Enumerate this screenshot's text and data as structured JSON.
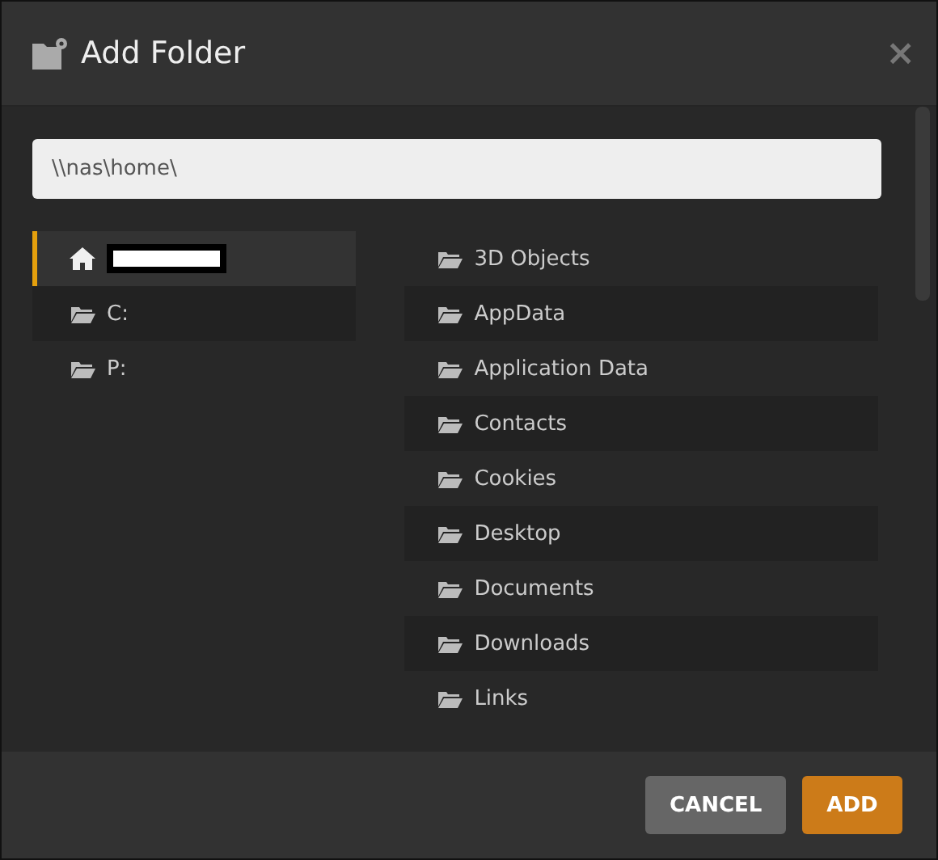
{
  "dialog": {
    "title": "Add Folder",
    "close": "×"
  },
  "path_field": {
    "value": "\\\\nas\\home\\"
  },
  "locations": [
    {
      "kind": "home",
      "redacted": true,
      "selected": true
    },
    {
      "kind": "folder",
      "label": "C:",
      "redacted": false,
      "selected": false
    },
    {
      "kind": "folder",
      "label": "P:",
      "redacted": false,
      "selected": false
    }
  ],
  "folders": [
    {
      "label": "3D Objects"
    },
    {
      "label": "AppData"
    },
    {
      "label": "Application Data"
    },
    {
      "label": "Contacts"
    },
    {
      "label": "Cookies"
    },
    {
      "label": "Desktop"
    },
    {
      "label": "Documents"
    },
    {
      "label": "Downloads"
    },
    {
      "label": "Links"
    }
  ],
  "buttons": [
    {
      "kind": "secondary",
      "label": "CANCEL"
    },
    {
      "kind": "primary",
      "label": "ADD"
    }
  ]
}
